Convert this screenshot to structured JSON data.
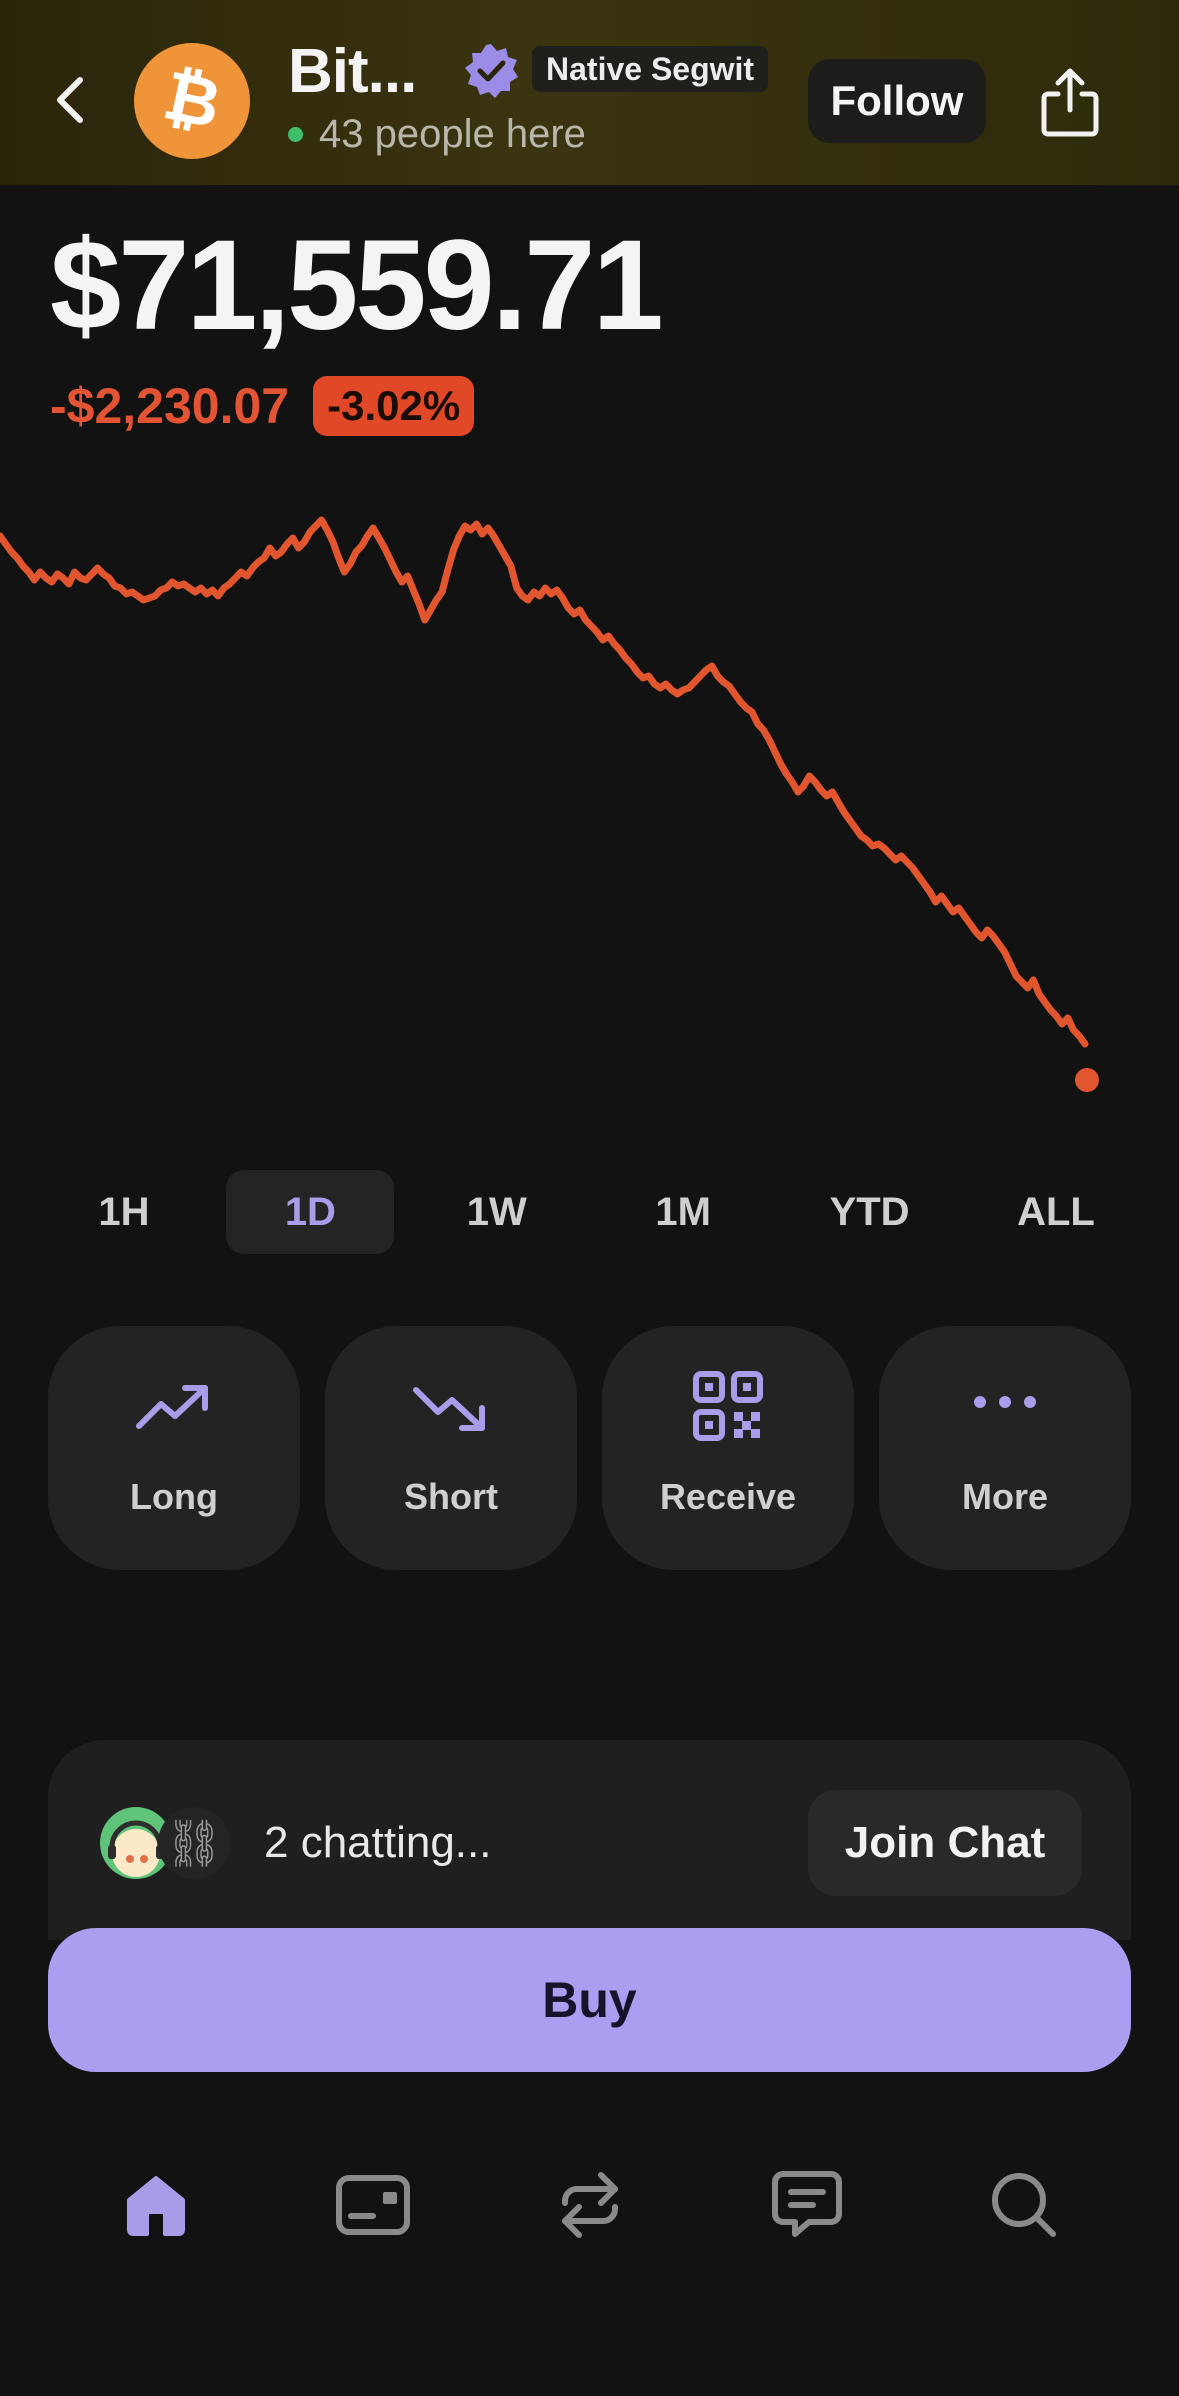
{
  "header": {
    "coin_name": "Bit...",
    "tag": "Native Segwit",
    "presence": "43 people here",
    "follow_label": "Follow",
    "coin_icon": "bitcoin-icon",
    "verified_icon": "verified-badge-icon",
    "share_icon": "share-icon",
    "back_icon": "chevron-left-icon"
  },
  "price": {
    "value": "$71,559.71",
    "change_abs": "-$2,230.07",
    "change_pct": "-3.02%"
  },
  "chart_data": {
    "type": "line",
    "x": [
      0,
      1,
      2,
      3,
      4,
      5,
      6,
      7,
      8,
      9,
      10,
      11,
      12,
      13,
      14,
      15,
      16,
      17,
      18,
      19,
      20,
      21,
      22,
      23,
      24,
      25,
      26,
      27,
      28,
      29,
      30,
      31,
      32,
      33,
      34,
      35,
      36,
      37,
      38,
      39,
      40,
      41,
      42,
      43,
      44,
      45,
      46,
      47,
      48,
      49,
      50,
      51,
      52,
      53,
      54,
      55,
      56,
      57,
      58,
      59,
      60,
      61,
      62,
      63,
      64,
      65,
      66,
      67,
      68,
      69,
      70,
      71,
      72,
      73,
      74,
      75,
      76,
      77,
      78,
      79,
      80,
      81,
      82,
      83,
      84,
      85,
      86,
      87,
      88,
      89,
      90,
      91,
      92,
      93,
      94,
      95,
      96,
      97,
      98,
      99,
      100,
      101,
      102,
      103,
      104,
      105,
      106,
      107,
      108,
      109,
      110,
      111,
      112,
      113,
      114,
      115,
      116,
      117,
      118,
      119,
      120,
      121,
      122,
      123,
      124,
      125,
      126,
      127,
      128,
      129,
      130,
      131,
      132,
      133,
      134,
      135,
      136,
      137,
      138,
      139,
      140,
      141,
      142,
      143,
      144,
      145,
      146,
      147,
      148,
      149,
      150,
      151,
      152,
      153,
      154,
      155,
      156,
      157,
      158,
      159,
      160,
      161,
      162,
      163,
      164,
      165,
      166,
      167,
      168,
      169,
      170,
      171,
      172,
      173,
      174,
      175,
      176,
      177,
      178,
      179,
      180,
      181,
      182,
      183,
      184,
      185,
      186,
      187,
      188,
      189
    ],
    "series": [
      {
        "values": [
          0.92,
          0.88,
          0.84,
          0.81,
          0.77,
          0.74,
          0.7,
          0.74,
          0.71,
          0.69,
          0.73,
          0.71,
          0.68,
          0.74,
          0.71,
          0.7,
          0.73,
          0.76,
          0.73,
          0.71,
          0.67,
          0.66,
          0.63,
          0.64,
          0.62,
          0.6,
          0.61,
          0.62,
          0.65,
          0.66,
          0.69,
          0.67,
          0.68,
          0.66,
          0.64,
          0.66,
          0.63,
          0.65,
          0.62,
          0.66,
          0.68,
          0.71,
          0.74,
          0.72,
          0.76,
          0.79,
          0.81,
          0.86,
          0.82,
          0.84,
          0.88,
          0.91,
          0.86,
          0.89,
          0.94,
          0.97,
          1.0,
          0.95,
          0.89,
          0.81,
          0.74,
          0.78,
          0.84,
          0.87,
          0.92,
          0.96,
          0.91,
          0.86,
          0.8,
          0.74,
          0.69,
          0.72,
          0.65,
          0.58,
          0.5,
          0.55,
          0.6,
          0.64,
          0.75,
          0.85,
          0.92,
          0.97,
          0.95,
          0.98,
          0.93,
          0.96,
          0.92,
          0.87,
          0.82,
          0.77,
          0.66,
          0.62,
          0.6,
          0.64,
          0.62,
          0.66,
          0.63,
          0.65,
          0.61,
          0.56,
          0.53,
          0.55,
          0.5,
          0.47,
          0.44,
          0.4,
          0.42,
          0.38,
          0.35,
          0.31,
          0.28,
          0.24,
          0.21,
          0.22,
          0.18,
          0.16,
          0.18,
          0.15,
          0.13,
          0.15,
          0.16,
          0.19,
          0.22,
          0.25,
          0.27,
          0.22,
          0.19,
          0.17,
          0.13,
          0.09,
          0.06,
          0.04,
          -0.02,
          -0.05,
          -0.1,
          -0.16,
          -0.22,
          -0.27,
          -0.31,
          -0.36,
          -0.33,
          -0.28,
          -0.31,
          -0.35,
          -0.38,
          -0.36,
          -0.41,
          -0.46,
          -0.5,
          -0.54,
          -0.58,
          -0.6,
          -0.63,
          -0.62,
          -0.64,
          -0.67,
          -0.7,
          -0.68,
          -0.71,
          -0.74,
          -0.78,
          -0.82,
          -0.86,
          -0.91,
          -0.88,
          -0.92,
          -0.96,
          -0.94,
          -0.98,
          -1.02,
          -1.06,
          -1.09,
          -1.05,
          -1.08,
          -1.12,
          -1.16,
          -1.22,
          -1.28,
          -1.31,
          -1.34,
          -1.3,
          -1.37,
          -1.41,
          -1.45,
          -1.48,
          -1.52,
          -1.49,
          -1.55,
          -1.58,
          -1.62,
          -1.66,
          -1.7
        ]
      }
    ],
    "color": "#e2562f"
  },
  "ranges": [
    "1H",
    "1D",
    "1W",
    "1M",
    "YTD",
    "ALL"
  ],
  "active_range": "1D",
  "actions": [
    {
      "label": "Long",
      "icon": "trending-up-icon"
    },
    {
      "label": "Short",
      "icon": "trending-down-icon"
    },
    {
      "label": "Receive",
      "icon": "qr-code-icon"
    },
    {
      "label": "More",
      "icon": "more-dots-icon"
    }
  ],
  "chat": {
    "text": "2 chatting...",
    "join_label": "Join Chat"
  },
  "buy_label": "Buy",
  "nav": [
    {
      "icon": "home-icon"
    },
    {
      "icon": "wallet-card-icon"
    },
    {
      "icon": "swap-arrows-icon"
    },
    {
      "icon": "chat-bubble-icon"
    },
    {
      "icon": "search-icon"
    }
  ],
  "colors": {
    "accent": "#ab9ef0",
    "negative": "#e35434",
    "positive_dot": "#3fbf6a",
    "background": "#121212"
  }
}
